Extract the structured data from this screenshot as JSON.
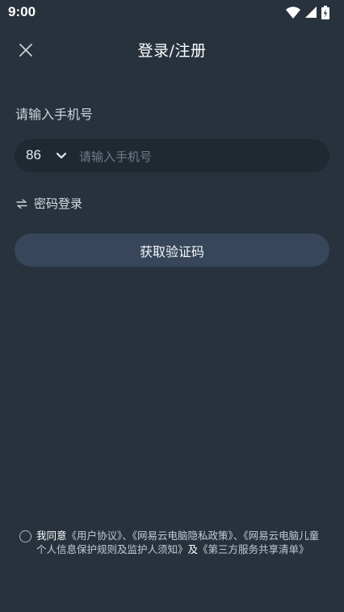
{
  "status_bar": {
    "time": "9:00"
  },
  "header": {
    "title": "登录/注册"
  },
  "form": {
    "phone_label": "请输入手机号",
    "country_code": "86",
    "phone_placeholder": "请输入手机号",
    "password_login_label": "密码登录",
    "get_code_label": "获取验证码"
  },
  "agreement": {
    "prefix": "我同意",
    "user_agreement": "《用户协议》",
    "sep1": "、",
    "privacy_policy": "《网易云电脑隐私政策》",
    "sep2": "、",
    "child_policy": "《网易云电脑儿童个人信息保护规则及监护人须知》",
    "and": "及",
    "third_party": "《第三方服务共享清单》"
  }
}
